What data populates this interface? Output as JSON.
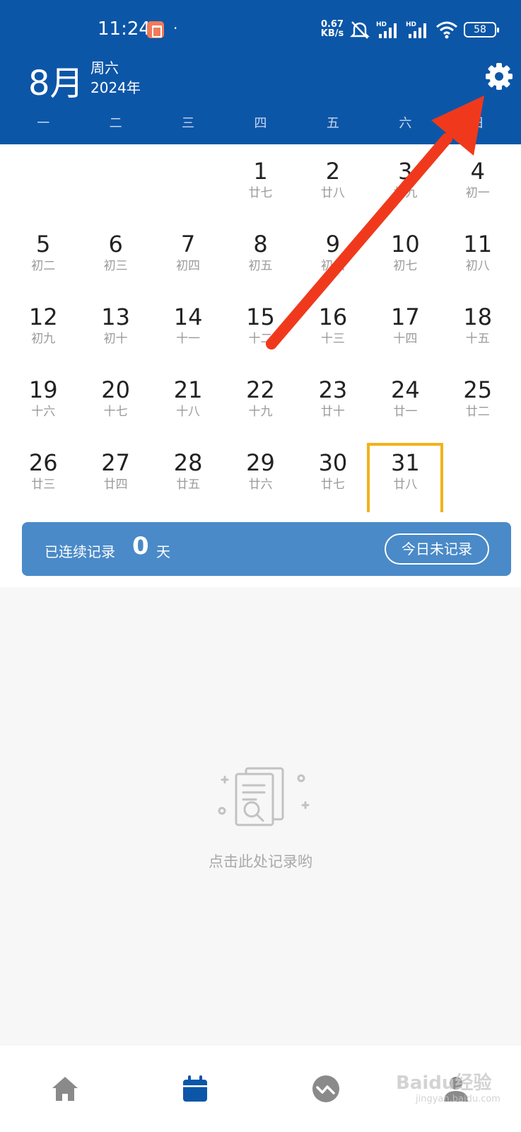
{
  "status_bar": {
    "time": "11:24",
    "dot": "·",
    "net_speed_value": "0.67",
    "net_speed_unit": "KB/s",
    "battery": "58",
    "icons": [
      "mute-icon",
      "signal-hd-icon",
      "signal-hd-icon",
      "wifi-icon",
      "battery-icon"
    ]
  },
  "header": {
    "month": "8月",
    "weekday": "周六",
    "year": "2024年",
    "settings_icon": "gear-icon"
  },
  "weekdays": [
    "一",
    "二",
    "三",
    "四",
    "五",
    "六",
    "日"
  ],
  "calendar": {
    "leading_blanks": 3,
    "days": [
      {
        "day": "1",
        "lunar": "廿七"
      },
      {
        "day": "2",
        "lunar": "廿八"
      },
      {
        "day": "3",
        "lunar": "廿九"
      },
      {
        "day": "4",
        "lunar": "初一"
      },
      {
        "day": "5",
        "lunar": "初二"
      },
      {
        "day": "6",
        "lunar": "初三"
      },
      {
        "day": "7",
        "lunar": "初四"
      },
      {
        "day": "8",
        "lunar": "初五"
      },
      {
        "day": "9",
        "lunar": "初六"
      },
      {
        "day": "10",
        "lunar": "初七"
      },
      {
        "day": "11",
        "lunar": "初八"
      },
      {
        "day": "12",
        "lunar": "初九"
      },
      {
        "day": "13",
        "lunar": "初十"
      },
      {
        "day": "14",
        "lunar": "十一"
      },
      {
        "day": "15",
        "lunar": "十二"
      },
      {
        "day": "16",
        "lunar": "十三"
      },
      {
        "day": "17",
        "lunar": "十四"
      },
      {
        "day": "18",
        "lunar": "十五"
      },
      {
        "day": "19",
        "lunar": "十六"
      },
      {
        "day": "20",
        "lunar": "十七"
      },
      {
        "day": "21",
        "lunar": "十八"
      },
      {
        "day": "22",
        "lunar": "十九"
      },
      {
        "day": "23",
        "lunar": "廿十"
      },
      {
        "day": "24",
        "lunar": "廿一"
      },
      {
        "day": "25",
        "lunar": "廿二"
      },
      {
        "day": "26",
        "lunar": "廿三"
      },
      {
        "day": "27",
        "lunar": "廿四"
      },
      {
        "day": "28",
        "lunar": "廿五"
      },
      {
        "day": "29",
        "lunar": "廿六"
      },
      {
        "day": "30",
        "lunar": "廿七"
      },
      {
        "day": "31",
        "lunar": "廿八",
        "today": true
      }
    ]
  },
  "streak": {
    "prefix": "已连续记录",
    "count": "0",
    "suffix": "天",
    "button": "今日未记录"
  },
  "empty_state": {
    "text": "点击此处记录哟",
    "icon": "document-search-icon"
  },
  "bottom_nav": [
    {
      "icon": "home-icon",
      "active": false
    },
    {
      "icon": "calendar-icon",
      "active": true
    },
    {
      "icon": "trend-icon",
      "active": false
    },
    {
      "icon": "profile-icon",
      "active": false
    }
  ],
  "colors": {
    "header_bg": "#0c56a8",
    "streak_bg": "#4a8ac8",
    "today_border": "#f1b21a",
    "annotation_arrow": "#f0391c"
  },
  "watermark": {
    "main": "Baidu经验",
    "sub": "jingyan.baidu.com"
  }
}
